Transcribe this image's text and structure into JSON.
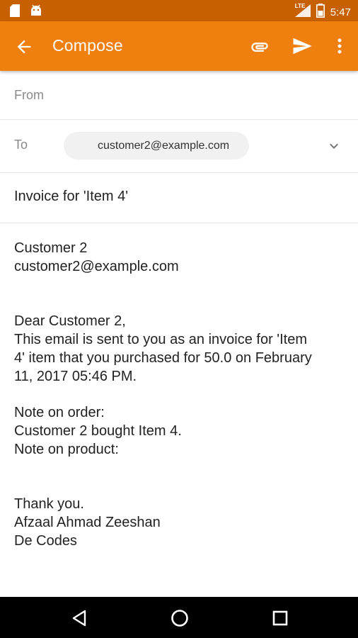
{
  "status_bar": {
    "time": "5:47",
    "network_label": "LTE",
    "icons": [
      "sd-card-icon",
      "android-icon",
      "signal-icon",
      "battery-icon"
    ]
  },
  "app_bar": {
    "title": "Compose",
    "background": "#ef7f0e",
    "icons": [
      "back-arrow-icon",
      "attachment-icon",
      "send-icon",
      "more-vert-icon"
    ]
  },
  "from": {
    "label": "From",
    "value": ""
  },
  "to": {
    "label": "To",
    "recipient": "customer2@example.com"
  },
  "subject": "Invoice for 'Item 4'",
  "message": {
    "lines": [
      "Customer 2",
      "customer2@example.com",
      "",
      "",
      "Dear Customer 2,",
      "This email is sent to you as an invoice for 'Item",
      "4' item that you purchased for 50.0 on February",
      "11, 2017 05:46 PM.",
      "",
      "Note on order:",
      "Customer 2 bought Item 4.",
      "Note on product:",
      "",
      "",
      "Thank you.",
      "Afzaal Ahmad Zeeshan",
      "De Codes"
    ]
  },
  "nav_bar": {
    "icons": [
      "back-triangle-icon",
      "home-circle-icon",
      "recents-square-icon"
    ]
  }
}
